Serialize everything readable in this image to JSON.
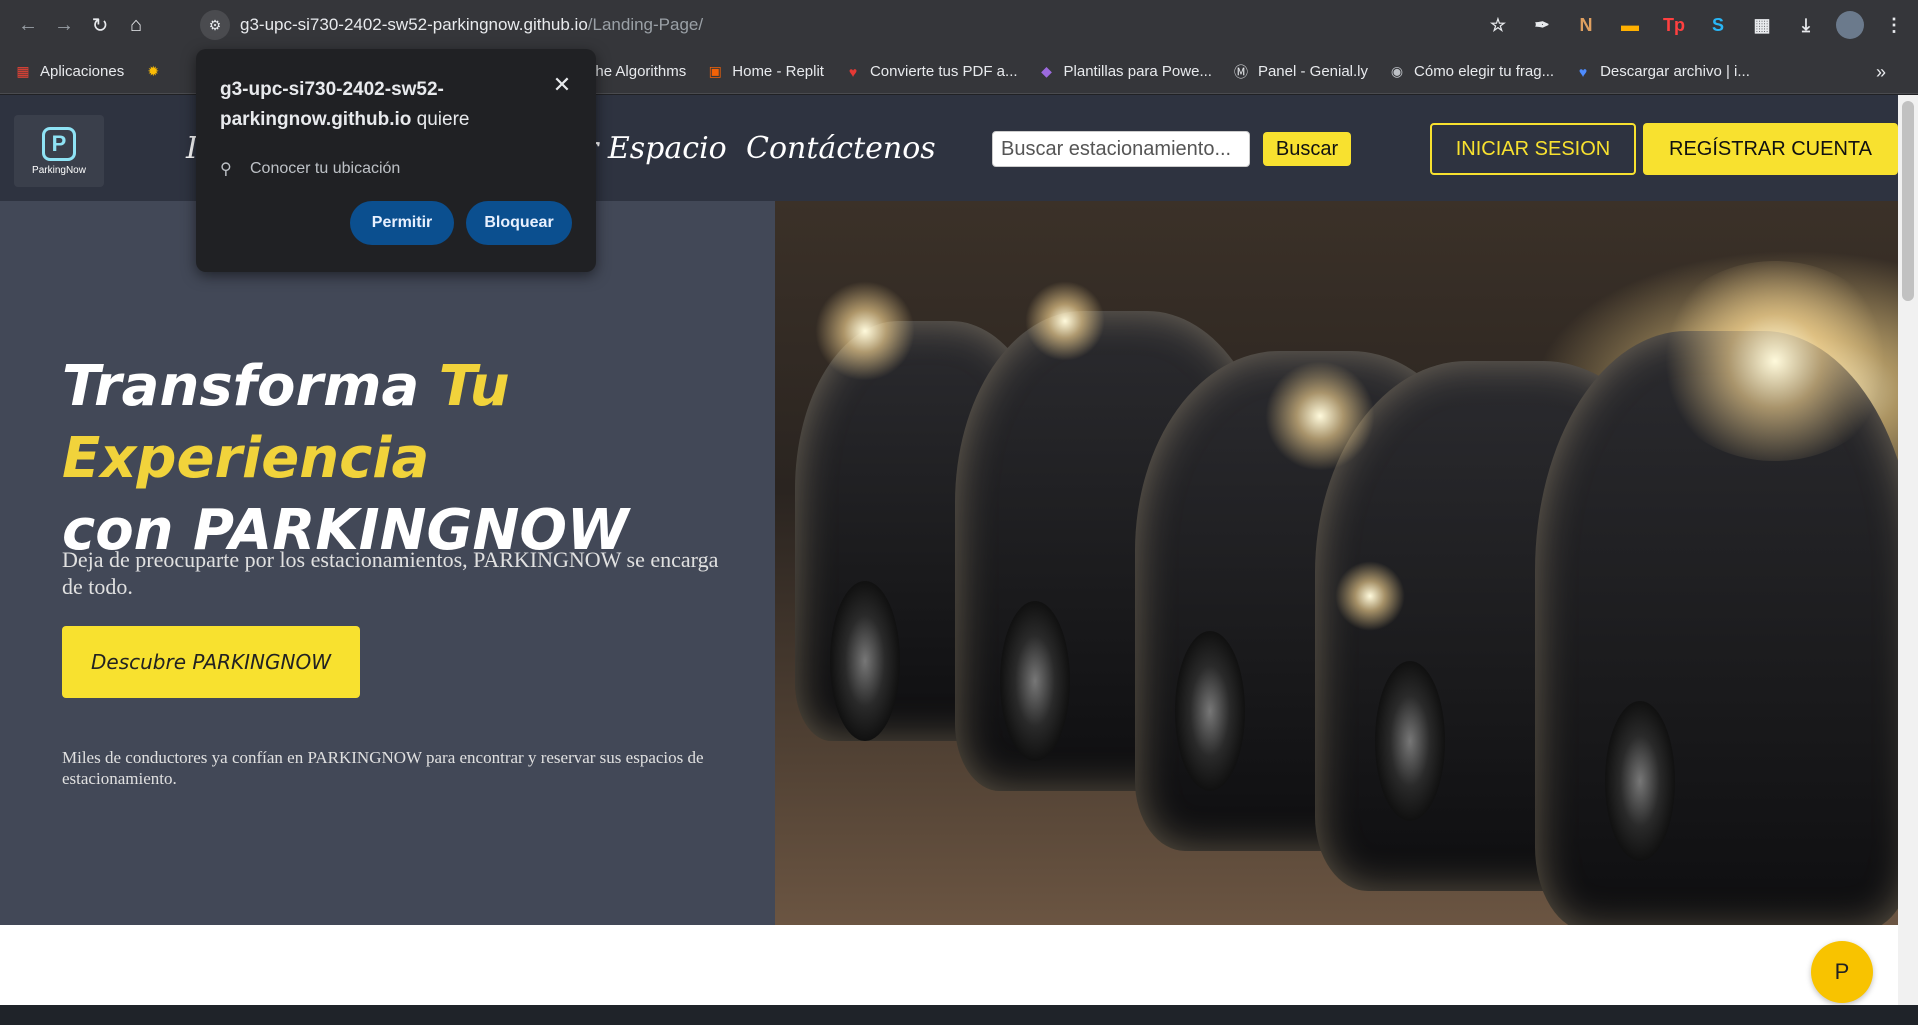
{
  "browser": {
    "url_host": "g3-upc-si730-2402-sw52-parkingnow.github.io",
    "url_path": "/Landing-Page/",
    "nav_back_icon": "back-arrow-icon",
    "nav_forward_icon": "forward-arrow-icon",
    "reload_icon": "reload-icon",
    "home_icon": "home-icon",
    "bookmarks": [
      {
        "label": "Aplicaciones",
        "icon": "apps-grid-icon"
      },
      {
        "label": "",
        "icon": "pinwheel-icon"
      },
      {
        "label": "The Algorithms",
        "icon": "algorithms-icon"
      },
      {
        "label": "Home - Replit",
        "icon": "replit-icon"
      },
      {
        "label": "Convierte tus PDF a...",
        "icon": "heart-icon"
      },
      {
        "label": "Plantillas para Powe...",
        "icon": "diamond-icon"
      },
      {
        "label": "Panel - Genial.ly",
        "icon": "genially-icon"
      },
      {
        "label": "Cómo elegir tu frag...",
        "icon": "globe-icon"
      },
      {
        "label": "Descargar archivo | i...",
        "icon": "blue-heart-icon"
      }
    ],
    "extensions": [
      "star-icon",
      "eyedropper-icon",
      "n-extension-icon",
      "car-extension-icon",
      "tp-extension-icon",
      "s-extension-icon",
      "puzzle-icon",
      "download-icon",
      "profile-avatar-icon",
      "menu-kebab-icon"
    ]
  },
  "permission_popup": {
    "host": "g3-upc-si730-2402-sw52-parkingnow.github.io",
    "suffix": "quiere",
    "request": "Conocer tu ubicación",
    "allow_label": "Permitir",
    "block_label": "Bloquear"
  },
  "site": {
    "logo_text": "ParkingNow",
    "logo_letter": "P",
    "nav_links": [
      {
        "label": "r Espacio"
      },
      {
        "label": "Contáctenos"
      }
    ],
    "search_placeholder": "Buscar estacionamiento...",
    "search_button": "Buscar",
    "login_button": "INICIAR SESION",
    "register_button": "REGÍSTRAR CUENTA",
    "hero_title_part1": "Transforma ",
    "hero_title_highlight": "Tu Experiencia",
    "hero_title_part2": "con PARKINGNOW",
    "hero_subtitle": "Deja de preocuparte por los estacionamientos, PARKINGNOW se encarga de todo.",
    "cta_label": "Descubre PARKINGNOW",
    "trust_text": "Miles de conductores ya confían en PARKINGNOW para encontrar y reservar sus espacios de estacionamiento.",
    "chat_fab_letter": "P"
  },
  "colors": {
    "accent_yellow": "#f8e12f",
    "nav_bg": "#2e3340",
    "hero_bg": "#424857",
    "popup_button": "#0b4f8f"
  }
}
